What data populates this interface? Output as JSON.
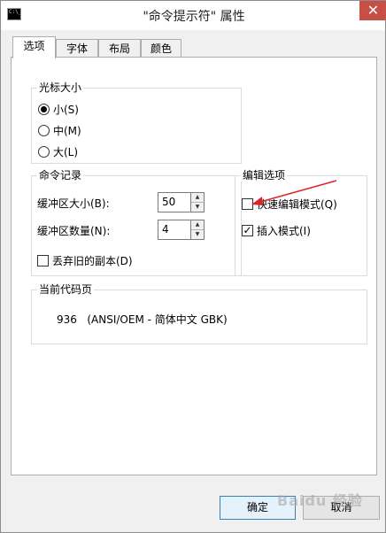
{
  "window": {
    "title": "\"命令提示符\" 属性",
    "icon_text": "C:\\_",
    "close_symbol": "✕"
  },
  "tabs": [
    {
      "label": "选项",
      "active": true
    },
    {
      "label": "字体",
      "active": false
    },
    {
      "label": "布局",
      "active": false
    },
    {
      "label": "颜色",
      "active": false
    }
  ],
  "cursor_size": {
    "label": "光标大小",
    "options": [
      {
        "label": "小(S)",
        "checked": true
      },
      {
        "label": "中(M)",
        "checked": false
      },
      {
        "label": "大(L)",
        "checked": false
      }
    ]
  },
  "command_history": {
    "label": "命令记录",
    "buffer_size_label": "缓冲区大小(B):",
    "buffer_size_value": "50",
    "buffer_count_label": "缓冲区数量(N):",
    "buffer_count_value": "4",
    "discard_label": "丢弃旧的副本(D)",
    "discard_checked": false
  },
  "edit_options": {
    "label": "编辑选项",
    "quick_edit_label": "快速编辑模式(Q)",
    "quick_edit_checked": false,
    "insert_mode_label": "插入模式(I)",
    "insert_mode_checked": true
  },
  "code_page": {
    "label": "当前代码页",
    "value": "936   (ANSI/OEM - 简体中文 GBK)"
  },
  "buttons": {
    "ok": "确定",
    "cancel": "取消"
  },
  "check_mark": "✓",
  "watermark": "Baidu 经验",
  "annotation_color": "#d9262b"
}
